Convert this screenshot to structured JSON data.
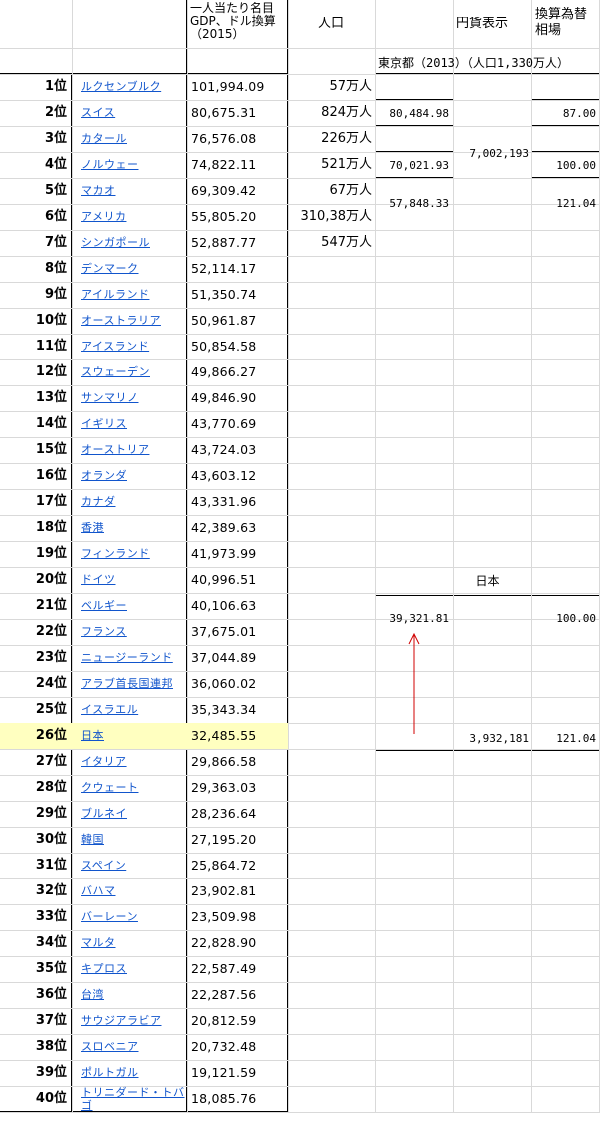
{
  "headers": {
    "gdp": "一人当たり名目GDP、ドル換算（2015）",
    "population": "人口",
    "yen": "円貨表示",
    "rate": "換算為替相場"
  },
  "rows": [
    {
      "rank": "1位",
      "country": "ルクセンブルク",
      "gdp": "101,994.09",
      "pop": "57万人"
    },
    {
      "rank": "2位",
      "country": "スイス",
      "gdp": "80,675.31",
      "pop": "824万人"
    },
    {
      "rank": "3位",
      "country": "カタール",
      "gdp": "76,576.08",
      "pop": "226万人"
    },
    {
      "rank": "4位",
      "country": "ノルウェー",
      "gdp": "74,822.11",
      "pop": "521万人"
    },
    {
      "rank": "5位",
      "country": "マカオ",
      "gdp": "69,309.42",
      "pop": "67万人"
    },
    {
      "rank": "6位",
      "country": "アメリカ",
      "gdp": "55,805.20",
      "pop": "310,38万人"
    },
    {
      "rank": "7位",
      "country": "シンガポール",
      "gdp": "52,887.77",
      "pop": "547万人"
    },
    {
      "rank": "8位",
      "country": "デンマーク",
      "gdp": "52,114.17",
      "pop": ""
    },
    {
      "rank": "9位",
      "country": "アイルランド",
      "gdp": "51,350.74",
      "pop": ""
    },
    {
      "rank": "10位",
      "country": "オーストラリア",
      "gdp": "50,961.87",
      "pop": ""
    },
    {
      "rank": "11位",
      "country": "アイスランド",
      "gdp": "50,854.58",
      "pop": ""
    },
    {
      "rank": "12位",
      "country": "スウェーデン",
      "gdp": "49,866.27",
      "pop": ""
    },
    {
      "rank": "13位",
      "country": "サンマリノ",
      "gdp": "49,846.90",
      "pop": ""
    },
    {
      "rank": "14位",
      "country": "イギリス",
      "gdp": "43,770.69",
      "pop": ""
    },
    {
      "rank": "15位",
      "country": "オーストリア",
      "gdp": "43,724.03",
      "pop": ""
    },
    {
      "rank": "16位",
      "country": "オランダ",
      "gdp": "43,603.12",
      "pop": ""
    },
    {
      "rank": "17位",
      "country": "カナダ",
      "gdp": "43,331.96",
      "pop": ""
    },
    {
      "rank": "18位",
      "country": "香港",
      "gdp": "42,389.63",
      "pop": ""
    },
    {
      "rank": "19位",
      "country": "フィンランド",
      "gdp": "41,973.99",
      "pop": ""
    },
    {
      "rank": "20位",
      "country": "ドイツ",
      "gdp": "40,996.51",
      "pop": ""
    },
    {
      "rank": "21位",
      "country": "ベルギー",
      "gdp": "40,106.63",
      "pop": ""
    },
    {
      "rank": "22位",
      "country": "フランス",
      "gdp": "37,675.01",
      "pop": ""
    },
    {
      "rank": "23位",
      "country": "ニュージーランド",
      "gdp": "37,044.89",
      "pop": ""
    },
    {
      "rank": "24位",
      "country": "アラブ首長国連邦",
      "gdp": "36,060.02",
      "pop": ""
    },
    {
      "rank": "25位",
      "country": "イスラエル",
      "gdp": "35,343.34",
      "pop": ""
    },
    {
      "rank": "26位",
      "country": "日本",
      "gdp": "32,485.55",
      "pop": "",
      "highlight": true
    },
    {
      "rank": "27位",
      "country": "イタリア",
      "gdp": "29,866.58",
      "pop": ""
    },
    {
      "rank": "28位",
      "country": "クウェート",
      "gdp": "29,363.03",
      "pop": ""
    },
    {
      "rank": "29位",
      "country": "ブルネイ",
      "gdp": "28,236.64",
      "pop": ""
    },
    {
      "rank": "30位",
      "country": "韓国",
      "gdp": "27,195.20",
      "pop": ""
    },
    {
      "rank": "31位",
      "country": "スペイン",
      "gdp": "25,864.72",
      "pop": ""
    },
    {
      "rank": "32位",
      "country": "バハマ",
      "gdp": "23,902.81",
      "pop": ""
    },
    {
      "rank": "33位",
      "country": "バーレーン",
      "gdp": "23,509.98",
      "pop": ""
    },
    {
      "rank": "34位",
      "country": "マルタ",
      "gdp": "22,828.90",
      "pop": ""
    },
    {
      "rank": "35位",
      "country": "キプロス",
      "gdp": "22,587.49",
      "pop": ""
    },
    {
      "rank": "36位",
      "country": "台湾",
      "gdp": "22,287.56",
      "pop": ""
    },
    {
      "rank": "37位",
      "country": "サウジアラビア",
      "gdp": "20,812.59",
      "pop": ""
    },
    {
      "rank": "38位",
      "country": "スロベニア",
      "gdp": "20,732.48",
      "pop": ""
    },
    {
      "rank": "39位",
      "country": "ポルトガル",
      "gdp": "19,121.59",
      "pop": ""
    },
    {
      "rank": "40位",
      "country": "トリニダード・トバゴ",
      "gdp": "18,085.76",
      "pop": ""
    }
  ],
  "tokyo": {
    "label": "東京都（2013）（人口1,330万人）",
    "values": [
      "80,484.98",
      "70,021.93",
      "57,848.33"
    ],
    "yen_total": "7,002,193",
    "rates": [
      "87.00",
      "100.00",
      "121.04"
    ]
  },
  "japan": {
    "label": "日本",
    "value": "39,321.81",
    "rate_top": "100.00",
    "yen_total": "3,932,181",
    "rate_bottom": "121.04"
  },
  "colors": {
    "highlight": "#ffffc0",
    "link": "#1155cc",
    "arrow": "#d00000",
    "grid": "#d9d9d9"
  }
}
